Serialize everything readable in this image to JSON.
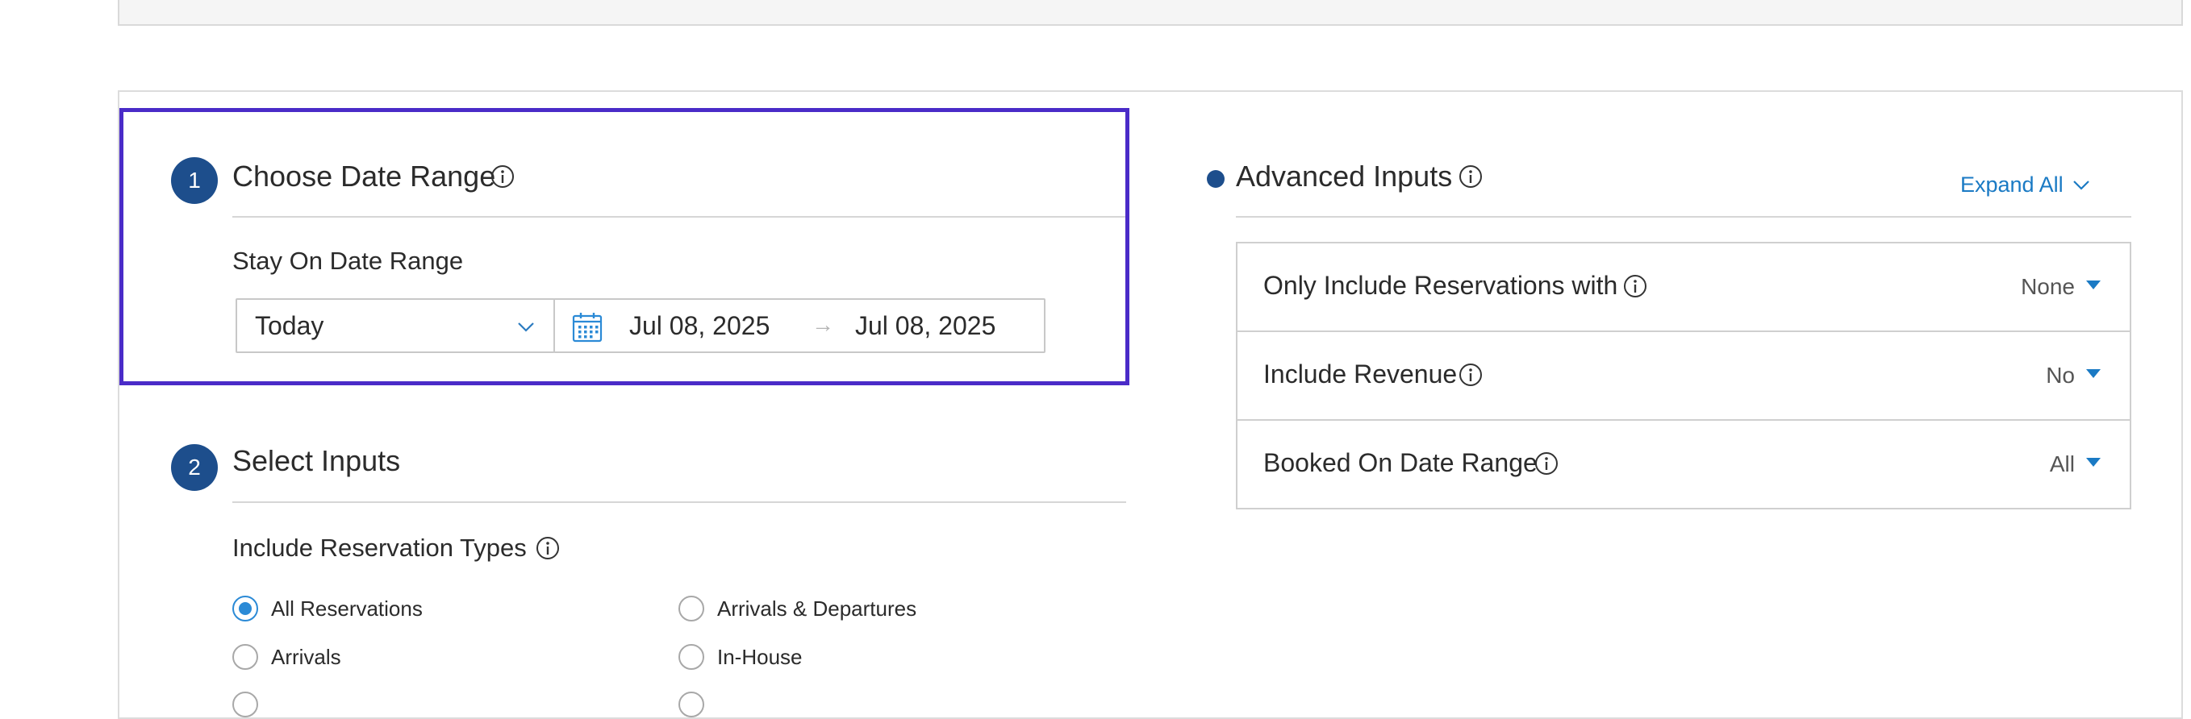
{
  "section1": {
    "step": "1",
    "title": "Choose Date Range",
    "field_label": "Stay On Date Range",
    "range_select": "Today",
    "start_date": "Jul 08, 2025",
    "end_date": "Jul 08, 2025"
  },
  "section2": {
    "step": "2",
    "title": "Select Inputs",
    "field_label": "Include Reservation Types",
    "options": [
      {
        "label": "All Reservations",
        "checked": true
      },
      {
        "label": "Arrivals & Departures",
        "checked": false
      },
      {
        "label": "Arrivals",
        "checked": false
      },
      {
        "label": "In-House",
        "checked": false
      }
    ]
  },
  "advanced": {
    "title": "Advanced Inputs",
    "expand_label": "Expand All",
    "rows": [
      {
        "label": "Only Include Reservations with",
        "value": "None"
      },
      {
        "label": "Include Revenue",
        "value": "No"
      },
      {
        "label": "Booked On Date Range",
        "value": "All"
      }
    ]
  },
  "colors": {
    "accent": "#1d4e8c",
    "link": "#1a7ac4",
    "highlight": "#4a2bc8",
    "radio_checked": "#2b8ad6"
  },
  "icons": [
    "info-icon",
    "chevron-down-icon",
    "calendar-icon",
    "arrow-right-icon",
    "caret-down-icon"
  ]
}
